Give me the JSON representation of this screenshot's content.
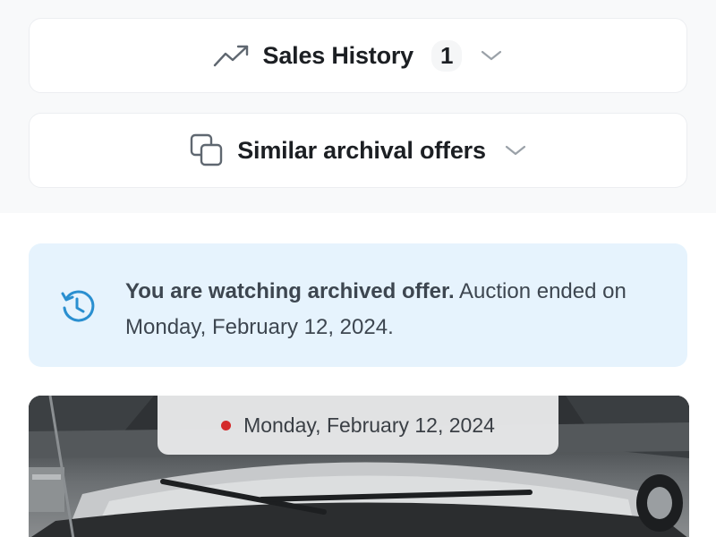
{
  "sections": {
    "sales_history": {
      "title": "Sales History",
      "count": "1",
      "icon": "trending-up-icon"
    },
    "similar_offers": {
      "title": "Similar archival offers",
      "icon": "copy-icon"
    }
  },
  "notice": {
    "icon": "history-icon",
    "bold_text": "You are watching archived offer.",
    "text": " Auction ended on Monday, February 12, 2024."
  },
  "photo": {
    "date": "Monday, February 12, 2024",
    "status_color": "#d42a2a"
  },
  "colors": {
    "notice_bg": "#e6f3fd",
    "notice_icon": "#2a8fd0",
    "status_dot": "#d42a2a"
  }
}
